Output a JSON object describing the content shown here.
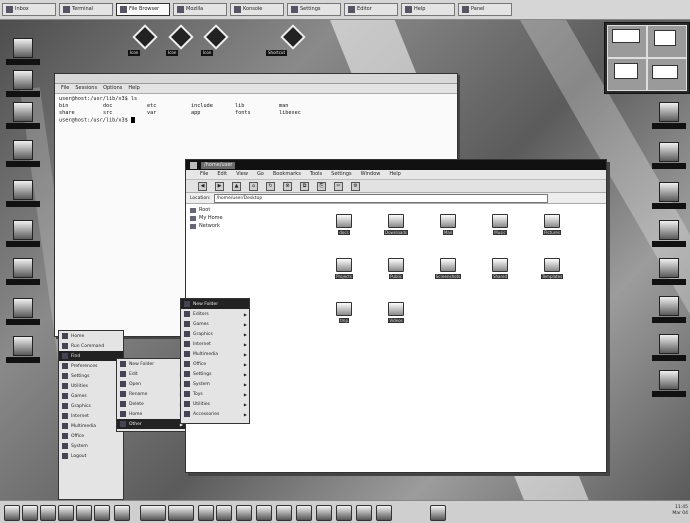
{
  "top_taskbar": {
    "tasks": [
      {
        "label": "Inbox"
      },
      {
        "label": "Terminal"
      },
      {
        "label": "File Browser"
      },
      {
        "label": "Mozilla"
      },
      {
        "label": "Konsole"
      },
      {
        "label": "Settings"
      },
      {
        "label": "Editor"
      },
      {
        "label": "Help"
      },
      {
        "label": "Panel"
      }
    ]
  },
  "desktop_icons": {
    "top": [
      "Icon",
      "Icon",
      "Icon",
      "Shortcut"
    ]
  },
  "terminal": {
    "menu": [
      "File",
      "Sessions",
      "Options",
      "Help"
    ],
    "prompt_line": "user@host:/usr/lib/x3$ ls",
    "rows": [
      [
        "bin",
        "doc",
        "etc",
        "include",
        "lib",
        "man"
      ],
      [
        "share",
        "src",
        "var",
        "app",
        "fonts",
        "libexec"
      ]
    ],
    "last_prompt": "user@host:/usr/lib/x3$"
  },
  "file_manager": {
    "title": "/home/user",
    "menu": [
      "File",
      "Edit",
      "View",
      "Go",
      "Bookmarks",
      "Tools",
      "Settings",
      "Window",
      "Help"
    ],
    "toolbar": [
      "◀",
      "▶",
      "▲",
      "⌂",
      "↻",
      "⊗",
      "⧉",
      "⎘",
      "✂",
      "⚙"
    ],
    "location_label": "Location:",
    "location": "/home/user/Desktop",
    "tree": [
      "Root",
      "My Home",
      "Network"
    ],
    "files": [
      "docs",
      "Downloads",
      "Mail",
      "Music",
      "Pictures",
      "Projects",
      "Public",
      "Screenshots",
      "Shared",
      "Templates",
      "tmp",
      "Videos"
    ]
  },
  "start_menu": {
    "items": [
      "Home",
      "Run Command",
      "Find",
      "Preferences",
      "Settings",
      "Utilities",
      "Games",
      "Graphics",
      "Internet",
      "Multimedia",
      "Office",
      "System",
      "Logout"
    ],
    "submenu1": [
      "New Folder",
      "Edit",
      "Open",
      "Rename",
      "Delete",
      "Home",
      "Other"
    ],
    "submenu2": [
      "New Folder",
      "Editors",
      "Games",
      "Graphics",
      "Internet",
      "Multimedia",
      "Office",
      "Settings",
      "System",
      "Toys",
      "Utilities",
      "Accessories"
    ]
  },
  "clock": {
    "time": "11:45",
    "date": "Mar 04"
  }
}
